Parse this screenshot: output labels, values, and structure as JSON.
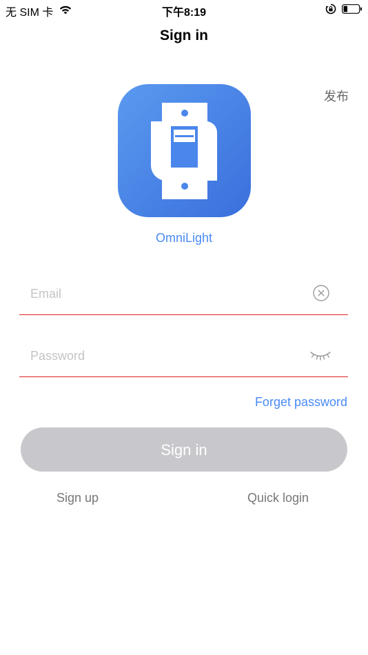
{
  "status_bar": {
    "carrier": "无 SIM 卡",
    "time": "下午8:19",
    "wifi_icon": "wifi-icon",
    "orientation_lock_icon": "orientation-lock-icon",
    "battery_icon": "battery-icon"
  },
  "nav": {
    "title": "Sign in",
    "publish_label": "发布"
  },
  "app": {
    "icon": "light-switch-icon",
    "name": "OmniLight",
    "icon_gradient": [
      "#5a9af0",
      "#3a6fdc"
    ]
  },
  "form": {
    "email": {
      "value": "",
      "placeholder": "Email",
      "clear_icon": "clear-circle-icon"
    },
    "password": {
      "value": "",
      "placeholder": "Password",
      "visibility_icon": "eye-closed-icon"
    },
    "forget_password_label": "Forget password",
    "sign_in_label": "Sign in"
  },
  "footer": {
    "sign_up_label": "Sign up",
    "quick_login_label": "Quick login"
  },
  "colors": {
    "accent": "#4a8af4",
    "field_underline": "#e02020",
    "button_disabled": "#c8c8cc"
  }
}
